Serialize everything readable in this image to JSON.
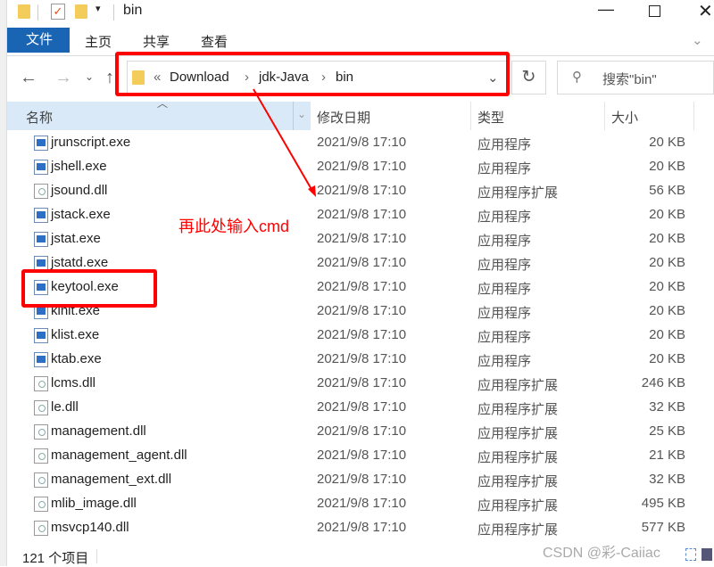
{
  "window": {
    "title": "bin"
  },
  "ribbon": {
    "tabs": [
      "文件",
      "主页",
      "共享",
      "查看"
    ]
  },
  "address": {
    "crumbs": [
      "Download",
      "jdk-Java",
      "bin"
    ],
    "overflow": "«"
  },
  "search": {
    "placeholder": "搜索\"bin\""
  },
  "columns": {
    "name": "名称",
    "date": "修改日期",
    "type": "类型",
    "size": "大小"
  },
  "files": [
    {
      "name": "jrunscript.exe",
      "date": "2021/9/8 17:10",
      "type": "应用程序",
      "size": "20 KB",
      "icon": "exe"
    },
    {
      "name": "jshell.exe",
      "date": "2021/9/8 17:10",
      "type": "应用程序",
      "size": "20 KB",
      "icon": "exe"
    },
    {
      "name": "jsound.dll",
      "date": "2021/9/8 17:10",
      "type": "应用程序扩展",
      "size": "56 KB",
      "icon": "dll"
    },
    {
      "name": "jstack.exe",
      "date": "2021/9/8 17:10",
      "type": "应用程序",
      "size": "20 KB",
      "icon": "exe"
    },
    {
      "name": "jstat.exe",
      "date": "2021/9/8 17:10",
      "type": "应用程序",
      "size": "20 KB",
      "icon": "exe"
    },
    {
      "name": "jstatd.exe",
      "date": "2021/9/8 17:10",
      "type": "应用程序",
      "size": "20 KB",
      "icon": "exe"
    },
    {
      "name": "keytool.exe",
      "date": "2021/9/8 17:10",
      "type": "应用程序",
      "size": "20 KB",
      "icon": "exe"
    },
    {
      "name": "kinit.exe",
      "date": "2021/9/8 17:10",
      "type": "应用程序",
      "size": "20 KB",
      "icon": "exe"
    },
    {
      "name": "klist.exe",
      "date": "2021/9/8 17:10",
      "type": "应用程序",
      "size": "20 KB",
      "icon": "exe"
    },
    {
      "name": "ktab.exe",
      "date": "2021/9/8 17:10",
      "type": "应用程序",
      "size": "20 KB",
      "icon": "exe"
    },
    {
      "name": "lcms.dll",
      "date": "2021/9/8 17:10",
      "type": "应用程序扩展",
      "size": "246 KB",
      "icon": "dll"
    },
    {
      "name": "le.dll",
      "date": "2021/9/8 17:10",
      "type": "应用程序扩展",
      "size": "32 KB",
      "icon": "dll"
    },
    {
      "name": "management.dll",
      "date": "2021/9/8 17:10",
      "type": "应用程序扩展",
      "size": "25 KB",
      "icon": "dll"
    },
    {
      "name": "management_agent.dll",
      "date": "2021/9/8 17:10",
      "type": "应用程序扩展",
      "size": "21 KB",
      "icon": "dll"
    },
    {
      "name": "management_ext.dll",
      "date": "2021/9/8 17:10",
      "type": "应用程序扩展",
      "size": "32 KB",
      "icon": "dll"
    },
    {
      "name": "mlib_image.dll",
      "date": "2021/9/8 17:10",
      "type": "应用程序扩展",
      "size": "495 KB",
      "icon": "dll"
    },
    {
      "name": "msvcp140.dll",
      "date": "2021/9/8 17:10",
      "type": "应用程序扩展",
      "size": "577 KB",
      "icon": "dll"
    }
  ],
  "status": {
    "count": "121 个项目"
  },
  "annotation": {
    "text": "再此处输入cmd",
    "color": "#ff0000"
  },
  "watermark": "CSDN @彩-Caiiac"
}
